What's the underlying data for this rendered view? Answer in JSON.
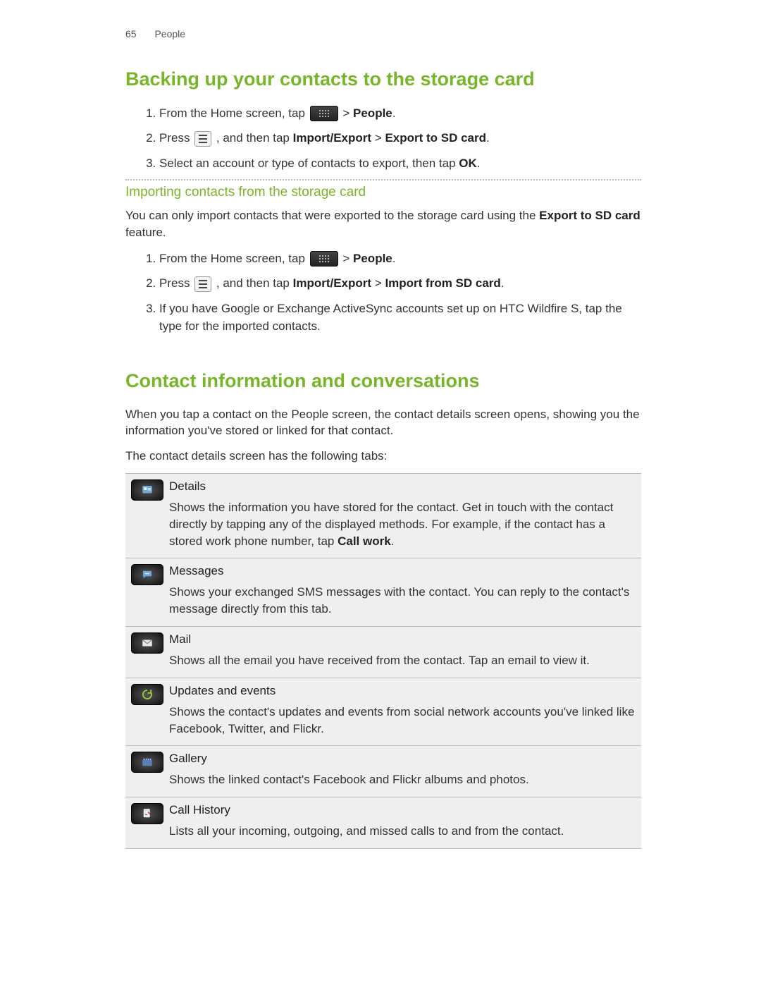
{
  "header": {
    "page_number": "65",
    "section": "People"
  },
  "h1_backup": "Backing up your contacts to the storage card",
  "backup_steps": {
    "s1_pre": "From the Home screen, tap ",
    "s1_post_gt": " > ",
    "s1_people": "People",
    "s2_pre": "Press ",
    "s2_mid": " , and then tap ",
    "s2_ie": "Import/Export",
    "s2_gt": " > ",
    "s2_export": "Export to SD card",
    "s3_pre": "Select an account or type of contacts to export, then tap ",
    "s3_ok": "OK"
  },
  "sub_import": "Importing contacts from the storage card",
  "import_intro_pre": "You can only import contacts that were exported to the storage card using the ",
  "import_intro_bold": "Export to SD card",
  "import_intro_post": " feature.",
  "import_steps": {
    "s1_pre": "From the Home screen, tap ",
    "s1_post_gt": " > ",
    "s1_people": "People",
    "s2_pre": "Press ",
    "s2_mid": " , and then tap ",
    "s2_ie": "Import/Export",
    "s2_gt": " > ",
    "s2_import": "Import from SD card",
    "s3": "If you have Google or Exchange ActiveSync accounts set up on HTC Wildfire S, tap the type for the imported contacts."
  },
  "h1_contactinfo": "Contact information and conversations",
  "ci_p1": "When you tap a contact on the People screen, the contact details screen opens, showing you the information you've stored or linked for that contact.",
  "ci_p2": "The contact details screen has the following tabs:",
  "tabs": [
    {
      "title": "Details",
      "desc_pre": "Shows the information you have stored for the contact. Get in touch with the contact directly by tapping any of the displayed methods. For example, if the contact has a stored work phone number, tap ",
      "desc_bold": "Call work",
      "desc_post": "."
    },
    {
      "title": "Messages",
      "desc": "Shows your exchanged SMS messages with the contact. You can reply to the contact's message directly from this tab."
    },
    {
      "title": "Mail",
      "desc": "Shows all the email you have received from the contact. Tap an email to view it."
    },
    {
      "title": "Updates and events",
      "desc": "Shows the contact's updates and events from social network accounts you've linked like Facebook, Twitter, and Flickr."
    },
    {
      "title": "Gallery",
      "desc": "Shows the linked contact's Facebook and Flickr albums and photos."
    },
    {
      "title": "Call History",
      "desc": "Lists all your incoming, outgoing, and missed calls to and from the contact."
    }
  ]
}
